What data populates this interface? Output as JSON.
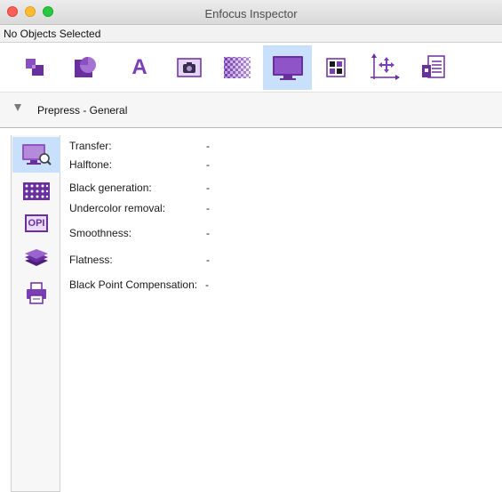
{
  "window": {
    "title": "Enfocus Inspector"
  },
  "selection": {
    "status": "No Objects Selected"
  },
  "toolbar": {
    "items": [
      {
        "icon": "object-arrange-icon",
        "active": false
      },
      {
        "icon": "shape-icon",
        "active": false
      },
      {
        "icon": "text-icon",
        "active": false,
        "glyph": "A"
      },
      {
        "icon": "image-icon",
        "active": false
      },
      {
        "icon": "shading-icon",
        "active": false
      },
      {
        "icon": "prepress-monitor-icon",
        "active": true
      },
      {
        "icon": "color-separation-icon",
        "active": false
      },
      {
        "icon": "position-icon",
        "active": false
      },
      {
        "icon": "document-info-icon",
        "active": false
      }
    ]
  },
  "section": {
    "label": "Prepress - General"
  },
  "sidebar": {
    "items": [
      {
        "icon": "monitor-search-icon",
        "active": true
      },
      {
        "icon": "halftone-icon",
        "active": false
      },
      {
        "icon": "opi-icon",
        "active": false,
        "glyph": "OPI"
      },
      {
        "icon": "layers-icon",
        "active": false
      },
      {
        "icon": "printer-icon",
        "active": false
      }
    ]
  },
  "properties": [
    {
      "label": "Transfer:",
      "value": "-"
    },
    {
      "label": "Halftone:",
      "value": "-"
    },
    {
      "label": "Black generation:",
      "value": "-"
    },
    {
      "label": "Undercolor removal:",
      "value": "-"
    },
    {
      "label": "Smoothness:",
      "value": "-"
    },
    {
      "label": "Flatness:",
      "value": "-"
    },
    {
      "label": "Black Point Compensation:",
      "value": "-"
    }
  ],
  "colors": {
    "accent": "#8a4fc0",
    "active_bg": "#c8e0fb"
  }
}
